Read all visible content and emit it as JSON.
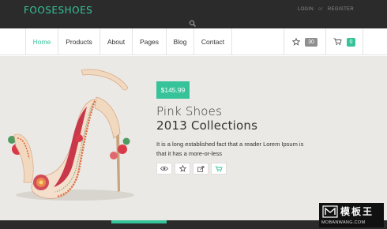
{
  "header": {
    "logo": "FOOSESHOES",
    "login": "LOGIN",
    "separator": "or",
    "register": "REGISTER",
    "search_icon": "search-icon"
  },
  "nav": {
    "items": [
      {
        "label": "Home",
        "active": true
      },
      {
        "label": "Products"
      },
      {
        "label": "About"
      },
      {
        "label": "Pages"
      },
      {
        "label": "Blog"
      },
      {
        "label": "Contact"
      }
    ],
    "wishlist": {
      "icon": "star-icon",
      "count": "30"
    },
    "cart": {
      "icon": "cart-icon",
      "count": "0"
    }
  },
  "hero": {
    "price": "$145.99",
    "title_line1": "Pink Shoes",
    "title_line2": "2013 Collections",
    "description": "It is a long established fact that a reader Lorem Ipsum is that it has a more-or-less",
    "actions": [
      "eye-icon",
      "star-icon",
      "share-icon",
      "cart-add-icon"
    ]
  },
  "watermark": {
    "title": "模板王",
    "url": "MOBANWANG.COM"
  },
  "colors": {
    "accent": "#36c39a",
    "dark": "#2b2b2b",
    "hero_bg": "#ebe9e5"
  }
}
